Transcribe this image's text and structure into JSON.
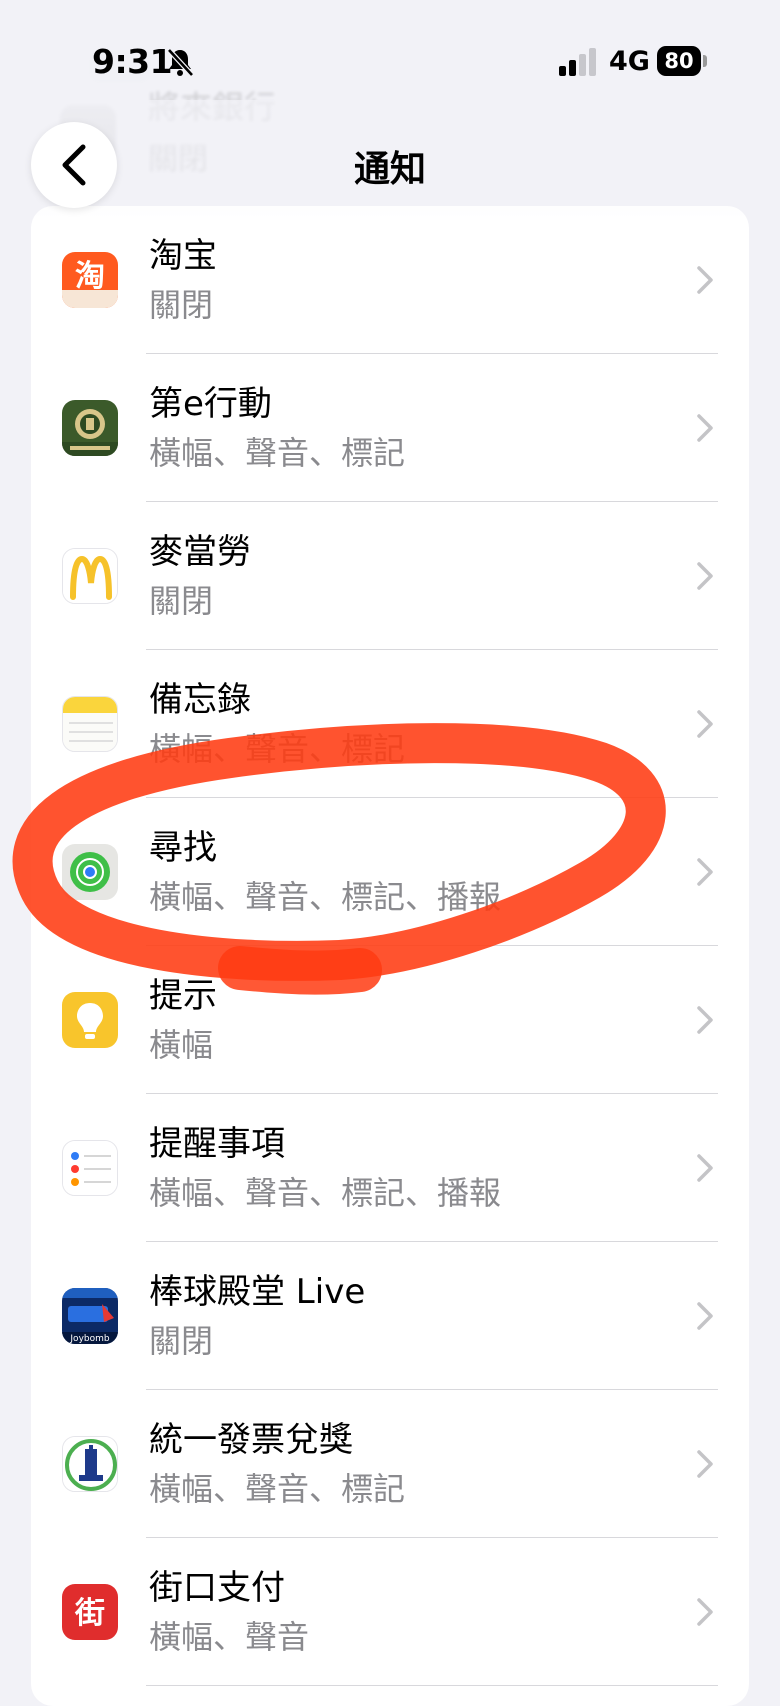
{
  "status_bar": {
    "time": "9:31",
    "network": "4G",
    "battery": "80"
  },
  "header": {
    "title": "通知"
  },
  "ghost_row": {
    "title": "將來銀行",
    "subtitle": "關閉"
  },
  "apps": [
    {
      "name": "淘宝",
      "subtitle": "關閉",
      "icon": "taobao-icon"
    },
    {
      "name": "第e行動",
      "subtitle": "橫幅、聲音、標記",
      "icon": "first-bank-icon"
    },
    {
      "name": "麥當勞",
      "subtitle": "關閉",
      "icon": "mcdonalds-icon"
    },
    {
      "name": "備忘錄",
      "subtitle": "橫幅、聲音、標記",
      "icon": "notes-icon"
    },
    {
      "name": "尋找",
      "subtitle": "橫幅、聲音、標記、播報",
      "icon": "find-my-icon"
    },
    {
      "name": "提示",
      "subtitle": "橫幅",
      "icon": "tips-icon"
    },
    {
      "name": "提醒事項",
      "subtitle": "橫幅、聲音、標記、播報",
      "icon": "reminders-icon"
    },
    {
      "name": "棒球殿堂 Live",
      "subtitle": "關閉",
      "icon": "baseball-icon"
    },
    {
      "name": "統一發票兌獎",
      "subtitle": "橫幅、聲音、標記",
      "icon": "invoice-lottery-icon"
    },
    {
      "name": "街口支付",
      "subtitle": "橫幅、聲音",
      "icon": "jkopay-icon"
    }
  ],
  "icon_text": {
    "taobao": "淘",
    "jkopay": "街",
    "joybomb": "Joybomb"
  },
  "colors": {
    "annotation": "#ff3b12",
    "chevron": "#c4c4c7",
    "secondary_text": "#8a8a8e"
  }
}
